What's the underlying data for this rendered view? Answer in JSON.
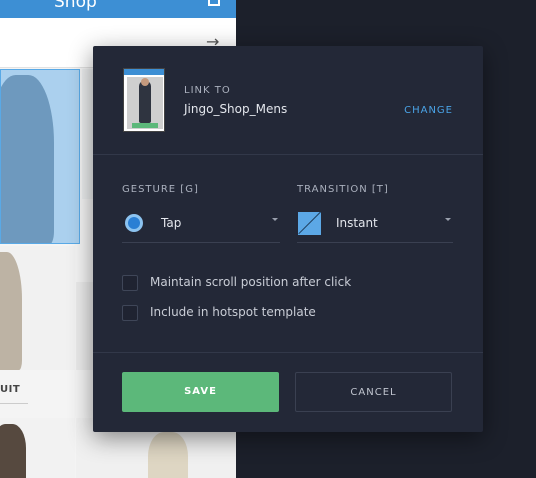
{
  "background_mockup": {
    "header_title": "Shop",
    "product_label": "UIT",
    "colors": {
      "header": "#3d8fd4",
      "hotspot": "#7cbef0"
    }
  },
  "dialog": {
    "link_caption": "LINK TO",
    "link_target": "Jingo_Shop_Mens",
    "change_label": "CHANGE",
    "gesture": {
      "caption": "GESTURE [G]",
      "value": "Tap",
      "icon": "tap-circle-icon"
    },
    "transition": {
      "caption": "TRANSITION [T]",
      "value": "Instant",
      "icon": "instant-transition-icon"
    },
    "options": [
      {
        "label": "Maintain scroll position after click",
        "checked": false
      },
      {
        "label": "Include in hotspot template",
        "checked": false
      }
    ],
    "save_label": "SAVE",
    "cancel_label": "CANCEL",
    "colors": {
      "background": "#232837",
      "accent": "#4aa3e6",
      "save": "#5cb87a"
    }
  }
}
